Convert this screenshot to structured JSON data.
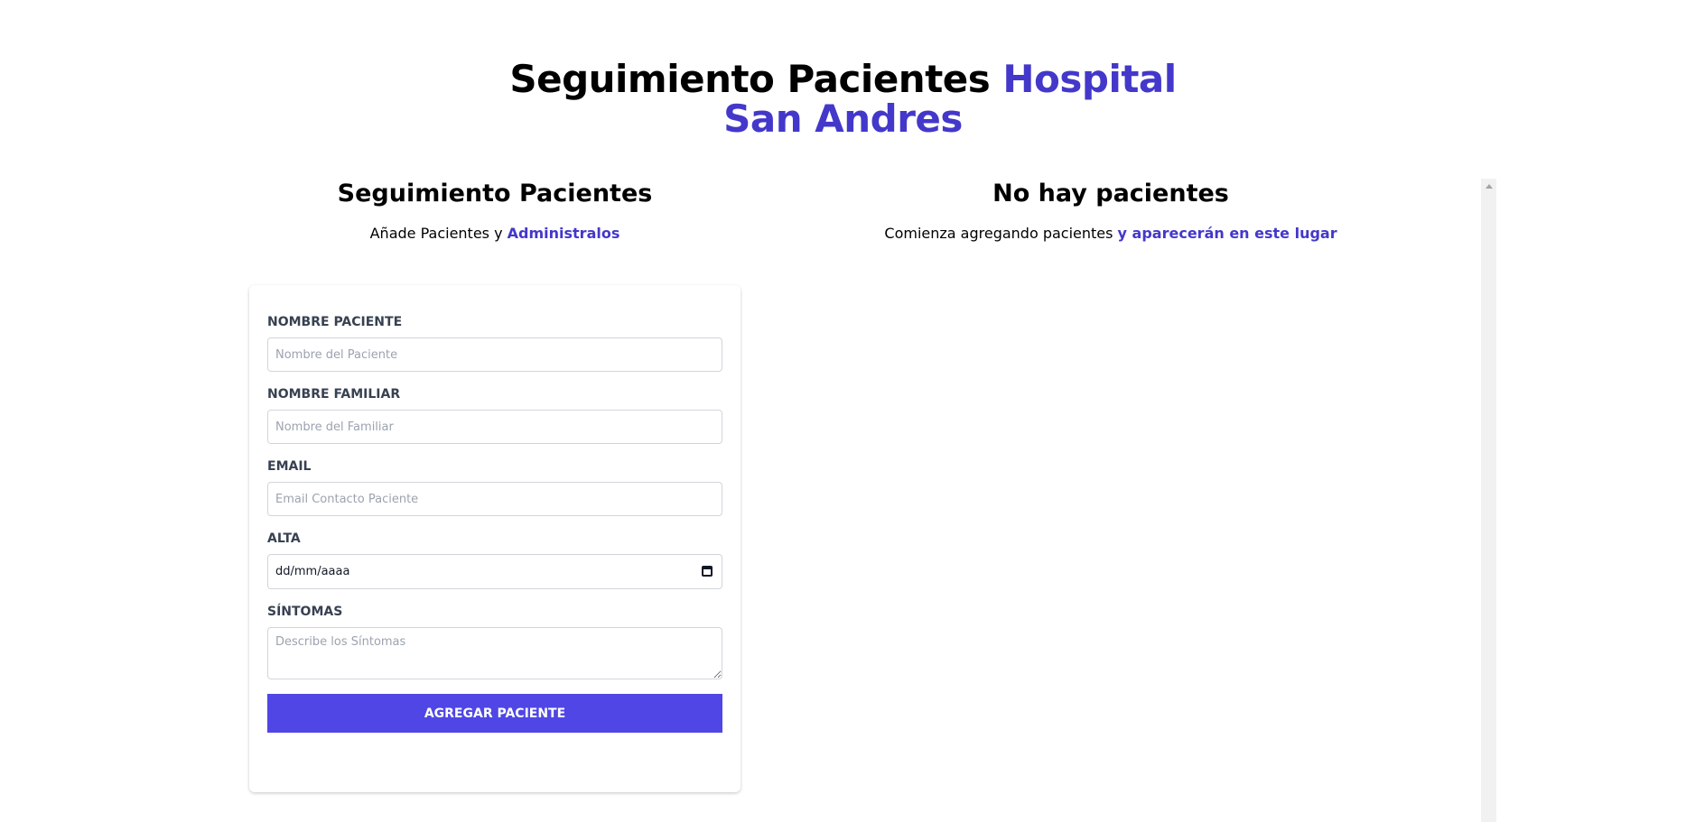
{
  "header": {
    "title_main": "Seguimiento Pacientes ",
    "title_accent": "Hospital San Andres"
  },
  "form_section": {
    "title": "Seguimiento Pacientes",
    "subtitle_text": "Añade Pacientes y ",
    "subtitle_accent": "Administralos"
  },
  "list_section": {
    "title": "No hay pacientes",
    "subtitle_text": "Comienza agregando pacientes ",
    "subtitle_accent": "y aparecerán en este lugar"
  },
  "form": {
    "fields": [
      {
        "label": "Nombre Paciente",
        "placeholder": "Nombre del Paciente",
        "value": ""
      },
      {
        "label": "Nombre Familiar",
        "placeholder": "Nombre del Familiar",
        "value": ""
      },
      {
        "label": "Email",
        "placeholder": "Email Contacto Paciente",
        "value": ""
      },
      {
        "label": "Alta",
        "display": "dd/mm/aaaa"
      },
      {
        "label": "Síntomas",
        "placeholder": "Describe los Síntomas",
        "value": ""
      }
    ],
    "submit_label": "Agregar Paciente"
  },
  "icons": {
    "date_picker": "calendar-icon",
    "scroll_up": "chevron-up-icon"
  },
  "colors": {
    "accent": "#4338ca",
    "button": "#4f46e5",
    "label": "#374151",
    "border": "#d1d5db"
  }
}
